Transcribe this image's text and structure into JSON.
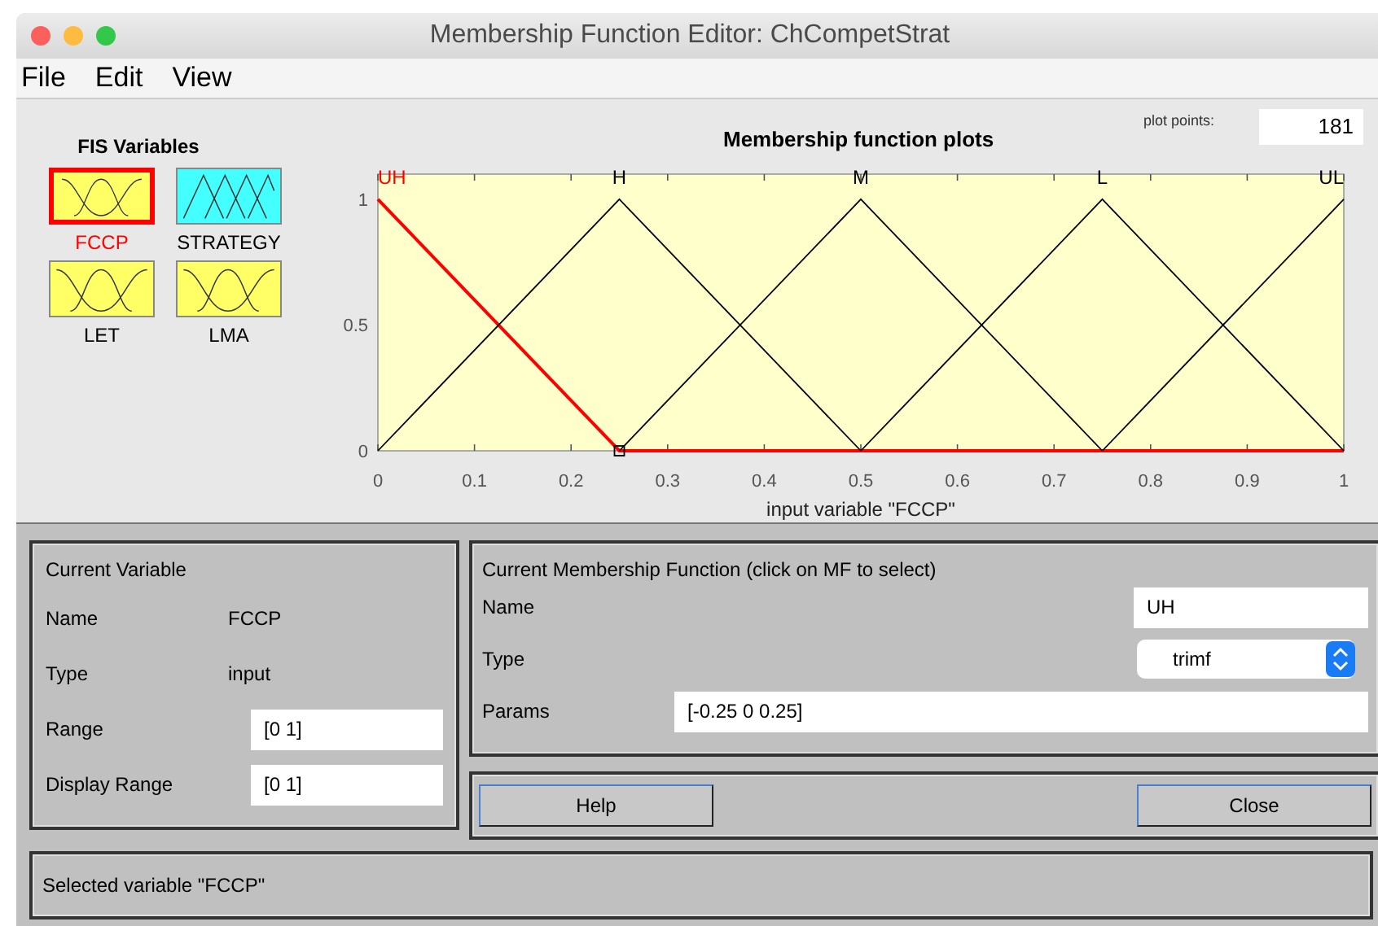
{
  "window": {
    "title": "Membership Function Editor: ChCompetStrat"
  },
  "menu": [
    "File",
    "Edit",
    "View"
  ],
  "fis_variables": {
    "title": "FIS Variables",
    "items": [
      {
        "name": "FCCP",
        "kind": "input",
        "selected": true
      },
      {
        "name": "STRATEGY",
        "kind": "output",
        "selected": false
      },
      {
        "name": "LET",
        "kind": "input",
        "selected": false
      },
      {
        "name": "LMA",
        "kind": "input",
        "selected": false
      }
    ]
  },
  "plot": {
    "plot_points_label": "plot points:",
    "plot_points": "181",
    "chart_data": {
      "type": "line",
      "title": "Membership function plots",
      "xlabel": "input variable \"FCCP\"",
      "x": [
        0,
        0.25,
        0.5,
        0.75,
        1
      ],
      "xlim": [
        0,
        1
      ],
      "ylim": [
        0,
        1.1
      ],
      "xticks": [
        0,
        0.1,
        0.2,
        0.3,
        0.4,
        0.5,
        0.6,
        0.7,
        0.8,
        0.9,
        1
      ],
      "yticks": [
        0,
        0.5,
        1
      ],
      "series": [
        {
          "name": "UH",
          "color": "#ff0000",
          "values": [
            1,
            0,
            0,
            0,
            0
          ]
        },
        {
          "name": "H",
          "color": "#000000",
          "values": [
            0,
            1,
            0,
            null,
            null
          ]
        },
        {
          "name": "M",
          "color": "#000000",
          "values": [
            null,
            0,
            1,
            0,
            null
          ]
        },
        {
          "name": "L",
          "color": "#000000",
          "values": [
            null,
            null,
            0,
            1,
            0
          ]
        },
        {
          "name": "UL",
          "color": "#000000",
          "values": [
            null,
            null,
            null,
            0,
            1
          ]
        }
      ]
    }
  },
  "current_variable": {
    "title": "Current Variable",
    "rows": [
      {
        "label": "Name",
        "value": "FCCP",
        "kind": "text"
      },
      {
        "label": "Type",
        "value": "input",
        "kind": "text"
      },
      {
        "label": "Range",
        "value": "[0 1]",
        "kind": "field"
      },
      {
        "label": "Display Range",
        "value": "[0 1]",
        "kind": "field"
      }
    ]
  },
  "current_mf": {
    "title": "Current Membership Function (click on MF to select)",
    "name_label": "Name",
    "name": "UH",
    "type_label": "Type",
    "type": "trimf",
    "params_label": "Params",
    "params": "[-0.25 0 0.25]"
  },
  "buttons": [
    "Help",
    "Close"
  ],
  "status": "Selected variable \"FCCP\""
}
